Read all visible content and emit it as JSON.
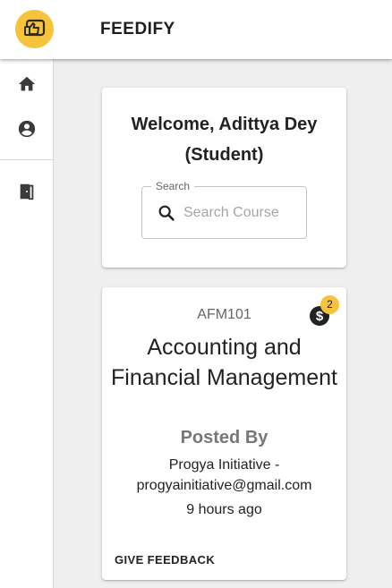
{
  "app": {
    "brand": "FEEDIFY",
    "logo_icon": "thumbs-up-message-icon",
    "accent_color": "#f7c33d"
  },
  "sidebar": {
    "items": [
      {
        "icon": "home-icon"
      },
      {
        "icon": "account-circle-icon"
      },
      {
        "icon": "exit-door-icon"
      }
    ]
  },
  "welcome": {
    "title": "Welcome, Adittya Dey (Student)"
  },
  "search": {
    "label": "Search",
    "placeholder": "Search Course",
    "value": "",
    "icon": "search-icon"
  },
  "course": {
    "code": "AFM101",
    "title": "Accounting and Financial Management",
    "posted_by_label": "Posted By",
    "poster": "Progya Initiative - progyainitiative@gmail.com",
    "time_ago": "9 hours ago",
    "badge_count": "2",
    "badge_icon": "dollar-circle-icon",
    "action_label": "GIVE FEEDBACK"
  }
}
